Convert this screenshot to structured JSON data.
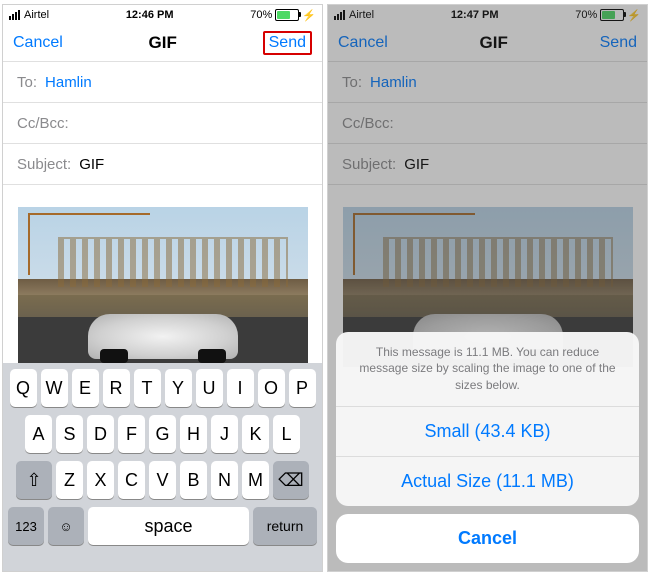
{
  "left": {
    "status": {
      "carrier": "Airtel",
      "time": "12:46 PM",
      "battery_pct": "70%"
    },
    "nav": {
      "cancel": "Cancel",
      "title": "GIF",
      "send": "Send"
    },
    "fields": {
      "to_label": "To:",
      "to_value": "Hamlin",
      "ccbcc_label": "Cc/Bcc:",
      "subject_label": "Subject:",
      "subject_value": "GIF"
    },
    "attachment": {
      "desc": "racing-car-gif"
    },
    "keyboard": {
      "row1": [
        "Q",
        "W",
        "E",
        "R",
        "T",
        "Y",
        "U",
        "I",
        "O",
        "P"
      ],
      "row2": [
        "A",
        "S",
        "D",
        "F",
        "G",
        "H",
        "J",
        "K",
        "L"
      ],
      "row3": [
        "Z",
        "X",
        "C",
        "V",
        "B",
        "N",
        "M"
      ],
      "numkey": "123",
      "space": "space",
      "return": "return"
    }
  },
  "right": {
    "status": {
      "carrier": "Airtel",
      "time": "12:47 PM",
      "battery_pct": "70%"
    },
    "nav": {
      "cancel": "Cancel",
      "title": "GIF",
      "send": "Send"
    },
    "fields": {
      "to_label": "To:",
      "to_value": "Hamlin",
      "ccbcc_label": "Cc/Bcc:",
      "subject_label": "Subject:",
      "subject_value": "GIF"
    },
    "attachment": {
      "desc": "racing-car-gif"
    },
    "sheet": {
      "message": "This message is 11.1 MB. You can reduce message size by scaling the image to one of the sizes below.",
      "options": [
        "Small (43.4 KB)",
        "Actual Size (11.1 MB)"
      ],
      "cancel": "Cancel"
    }
  }
}
